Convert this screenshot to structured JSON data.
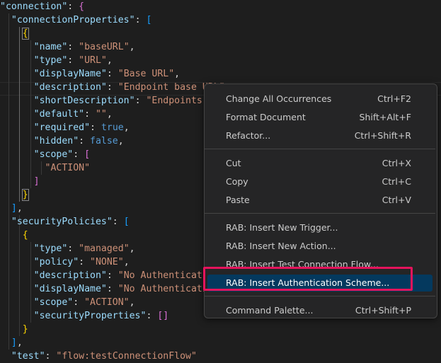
{
  "editor": {
    "lines": [
      {
        "segments": [
          {
            "t": "\"connection\"",
            "c": "k"
          },
          {
            "t": ": ",
            "c": "p"
          },
          {
            "t": "{",
            "c": "br-pink"
          }
        ]
      },
      {
        "segments": [
          {
            "t": "  \"connectionProperties\"",
            "c": "k"
          },
          {
            "t": ": ",
            "c": "p"
          },
          {
            "t": "[",
            "c": "br-blue"
          }
        ]
      },
      {
        "segments": [
          {
            "t": "    ",
            "c": "p"
          },
          {
            "t": "{",
            "c": "br-gold"
          }
        ]
      },
      {
        "segments": [
          {
            "t": "      \"name\"",
            "c": "k"
          },
          {
            "t": ": ",
            "c": "p"
          },
          {
            "t": "\"baseURL\"",
            "c": "s"
          },
          {
            "t": ",",
            "c": "p"
          }
        ]
      },
      {
        "segments": [
          {
            "t": "      \"type\"",
            "c": "k"
          },
          {
            "t": ": ",
            "c": "p"
          },
          {
            "t": "\"URL\"",
            "c": "s"
          },
          {
            "t": ",",
            "c": "p"
          }
        ]
      },
      {
        "segments": [
          {
            "t": "      \"displayName\"",
            "c": "k"
          },
          {
            "t": ": ",
            "c": "p"
          },
          {
            "t": "\"Base URL\"",
            "c": "s"
          },
          {
            "t": ",",
            "c": "p"
          }
        ]
      },
      {
        "segments": [
          {
            "t": "      \"description\"",
            "c": "k"
          },
          {
            "t": ": ",
            "c": "p"
          },
          {
            "t": "\"Endpoint base URL\"",
            "c": "s"
          },
          {
            "t": ",",
            "c": "p"
          }
        ]
      },
      {
        "segments": [
          {
            "t": "      \"shortDescription\"",
            "c": "k"
          },
          {
            "t": ": ",
            "c": "p"
          },
          {
            "t": "\"Endpoints base URL\"",
            "c": "s"
          },
          {
            "t": ",",
            "c": "p"
          }
        ]
      },
      {
        "segments": [
          {
            "t": "      \"default\"",
            "c": "k"
          },
          {
            "t": ": ",
            "c": "p"
          },
          {
            "t": "\"\"",
            "c": "s"
          },
          {
            "t": ",",
            "c": "p"
          }
        ]
      },
      {
        "segments": [
          {
            "t": "      \"required\"",
            "c": "k"
          },
          {
            "t": ": ",
            "c": "p"
          },
          {
            "t": "true",
            "c": "b"
          },
          {
            "t": ",",
            "c": "p"
          }
        ]
      },
      {
        "segments": [
          {
            "t": "      \"hidden\"",
            "c": "k"
          },
          {
            "t": ": ",
            "c": "p"
          },
          {
            "t": "false",
            "c": "b"
          },
          {
            "t": ",",
            "c": "p"
          }
        ]
      },
      {
        "segments": [
          {
            "t": "      \"scope\"",
            "c": "k"
          },
          {
            "t": ": ",
            "c": "p"
          },
          {
            "t": "[",
            "c": "br-pink"
          }
        ]
      },
      {
        "segments": [
          {
            "t": "        \"ACTION\"",
            "c": "s"
          }
        ]
      },
      {
        "segments": [
          {
            "t": "      ",
            "c": "p"
          },
          {
            "t": "]",
            "c": "br-pink"
          }
        ]
      },
      {
        "segments": [
          {
            "t": "    ",
            "c": "p"
          },
          {
            "t": "}",
            "c": "br-gold"
          }
        ]
      },
      {
        "segments": [
          {
            "t": "  ",
            "c": "p"
          },
          {
            "t": "]",
            "c": "br-blue"
          },
          {
            "t": ",",
            "c": "p"
          }
        ]
      },
      {
        "segments": [
          {
            "t": "  \"securityPolicies\"",
            "c": "k"
          },
          {
            "t": ": ",
            "c": "p"
          },
          {
            "t": "[",
            "c": "br-blue"
          }
        ]
      },
      {
        "segments": [
          {
            "t": "    ",
            "c": "p"
          },
          {
            "t": "{",
            "c": "br-gold"
          }
        ]
      },
      {
        "segments": [
          {
            "t": "      \"type\"",
            "c": "k"
          },
          {
            "t": ": ",
            "c": "p"
          },
          {
            "t": "\"managed\"",
            "c": "s"
          },
          {
            "t": ",",
            "c": "p"
          }
        ]
      },
      {
        "segments": [
          {
            "t": "      \"policy\"",
            "c": "k"
          },
          {
            "t": ": ",
            "c": "p"
          },
          {
            "t": "\"NONE\"",
            "c": "s"
          },
          {
            "t": ",",
            "c": "p"
          }
        ]
      },
      {
        "segments": [
          {
            "t": "      \"description\"",
            "c": "k"
          },
          {
            "t": ": ",
            "c": "p"
          },
          {
            "t": "\"No Authentication\"",
            "c": "s"
          },
          {
            "t": ",",
            "c": "p"
          }
        ]
      },
      {
        "segments": [
          {
            "t": "      \"displayName\"",
            "c": "k"
          },
          {
            "t": ": ",
            "c": "p"
          },
          {
            "t": "\"No Authentication\"",
            "c": "s"
          },
          {
            "t": ",",
            "c": "p"
          }
        ]
      },
      {
        "segments": [
          {
            "t": "      \"scope\"",
            "c": "k"
          },
          {
            "t": ": ",
            "c": "p"
          },
          {
            "t": "\"ACTION\"",
            "c": "s"
          },
          {
            "t": ",",
            "c": "p"
          }
        ]
      },
      {
        "segments": [
          {
            "t": "      \"securityProperties\"",
            "c": "k"
          },
          {
            "t": ": ",
            "c": "p"
          },
          {
            "t": "[]",
            "c": "br-pink"
          }
        ]
      },
      {
        "segments": [
          {
            "t": "    ",
            "c": "p"
          },
          {
            "t": "}",
            "c": "br-gold"
          }
        ]
      },
      {
        "segments": [
          {
            "t": "  ",
            "c": "p"
          },
          {
            "t": "]",
            "c": "br-blue"
          },
          {
            "t": ",",
            "c": "p"
          }
        ]
      },
      {
        "segments": [
          {
            "t": "  \"test\"",
            "c": "k"
          },
          {
            "t": ": ",
            "c": "p"
          },
          {
            "t": "\"flow:testConnectionFlow\"",
            "c": "s"
          }
        ]
      }
    ]
  },
  "context_menu": {
    "groups": [
      [
        {
          "label": "Change All Occurrences",
          "shortcut": "Ctrl+F2"
        },
        {
          "label": "Format Document",
          "shortcut": "Shift+Alt+F"
        },
        {
          "label": "Refactor...",
          "shortcut": "Ctrl+Shift+R"
        }
      ],
      [
        {
          "label": "Cut",
          "shortcut": "Ctrl+X"
        },
        {
          "label": "Copy",
          "shortcut": "Ctrl+C"
        },
        {
          "label": "Paste",
          "shortcut": "Ctrl+V"
        }
      ],
      [
        {
          "label": "RAB: Insert New Trigger...",
          "shortcut": ""
        },
        {
          "label": "RAB: Insert New Action...",
          "shortcut": ""
        },
        {
          "label": "RAB: Insert Test Connection Flow...",
          "shortcut": ""
        },
        {
          "label": "RAB: Insert Authentication Scheme...",
          "shortcut": "",
          "selected": true
        }
      ],
      [
        {
          "label": "Command Palette...",
          "shortcut": "Ctrl+Shift+P"
        }
      ]
    ]
  },
  "colors": {
    "highlight_border": "#e5145c",
    "selected_item_bg": "#04395e"
  }
}
